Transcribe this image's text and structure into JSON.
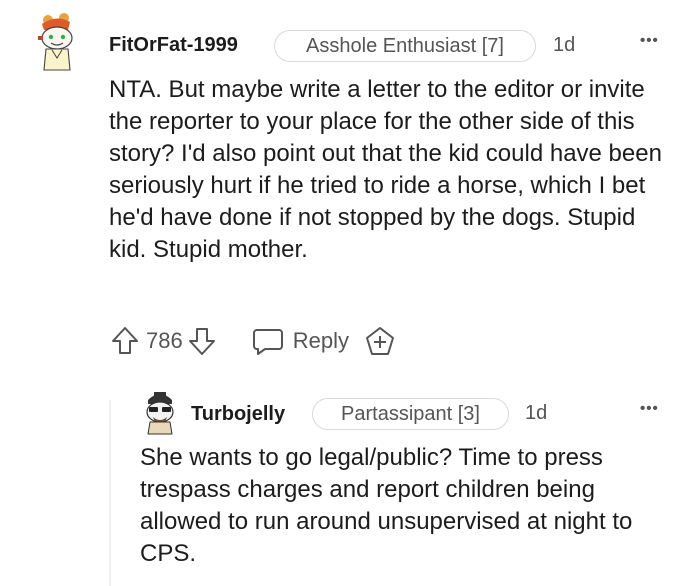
{
  "comments": [
    {
      "username": "FitOrFat-1999",
      "flair": "Asshole Enthusiast [7]",
      "time": "1d",
      "body": "NTA. But maybe write a letter to the editor or invite the reporter to your place for the other side of this story? I'd also point out that the kid could have been seriously hurt if he tried to ride a horse, which I bet he'd have done if not stopped by the dogs. Stupid kid. Stupid mother.",
      "score": "786",
      "reply_label": "Reply",
      "avatar_icon": "snoo-avatar-icon"
    },
    {
      "username": "Turbojelly",
      "flair": "Partassipant [3]",
      "time": "1d",
      "body": "She wants to go legal/public? Time to press trespass charges and report children being allowed to run around unsupervised at night to CPS.",
      "avatar_icon": "snoo-avatar-icon"
    }
  ],
  "icons": {
    "more": "more-options-icon",
    "upvote": "upvote-icon",
    "downvote": "downvote-icon",
    "reply": "reply-icon",
    "award": "award-icon"
  },
  "colors": {
    "text": "#1c1c1c",
    "meta": "#555555",
    "flair_border": "#d7dadc",
    "thread_line": "#edeff1"
  },
  "more_glyph": "•••"
}
